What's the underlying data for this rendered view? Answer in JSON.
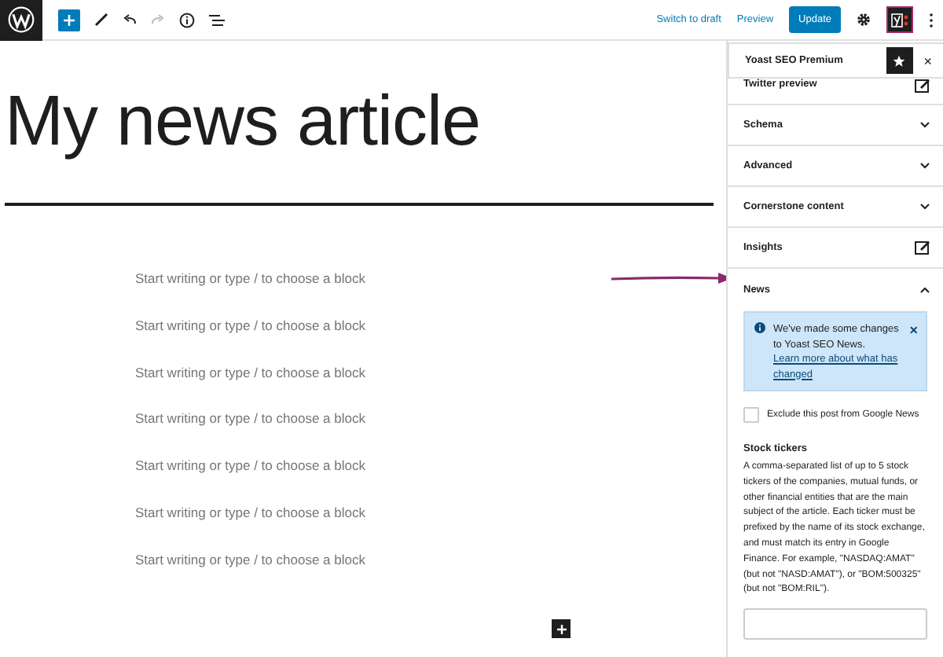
{
  "toolbar": {
    "switch_to_draft": "Switch to draft",
    "preview": "Preview",
    "update": "Update"
  },
  "editor": {
    "title": "My news article",
    "placeholders": [
      "Start writing or type / to choose a block",
      "Start writing or type / to choose a block",
      "Start writing or type / to choose a block",
      "Start writing or type / to choose a block",
      "Start writing or type / to choose a block",
      "Start writing or type / to choose a block",
      "Start writing or type / to choose a block"
    ]
  },
  "sidebar": {
    "title": "Yoast SEO Premium",
    "close": "×",
    "panels": [
      {
        "label": "Twitter preview",
        "kind": "edit",
        "expanded": false
      },
      {
        "label": "Schema",
        "kind": "toggle",
        "expanded": false
      },
      {
        "label": "Advanced",
        "kind": "toggle",
        "expanded": false
      },
      {
        "label": "Cornerstone content",
        "kind": "toggle",
        "expanded": false
      },
      {
        "label": "Insights",
        "kind": "edit",
        "expanded": false
      },
      {
        "label": "News",
        "kind": "toggle",
        "expanded": true
      }
    ],
    "notice": {
      "text": "We've made some changes to Yoast SEO News.",
      "link": "Learn more about what has changed",
      "dismiss": "×"
    },
    "exclude": {
      "label": "Exclude this post from Google News",
      "checked": false
    },
    "stock_tickers": {
      "heading": "Stock tickers",
      "description": "A comma-separated list of up to 5 stock tickers of the companies, mutual funds, or other financial entities that are the main subject of the article. Each ticker must be prefixed by the name of its stock exchange, and must match its entry in Google Finance. For example, \"NASDAQ:AMAT\" (but not \"NASD:AMAT\"), or \"BOM:500325\" (but not \"BOM:RIL\")."
    }
  }
}
